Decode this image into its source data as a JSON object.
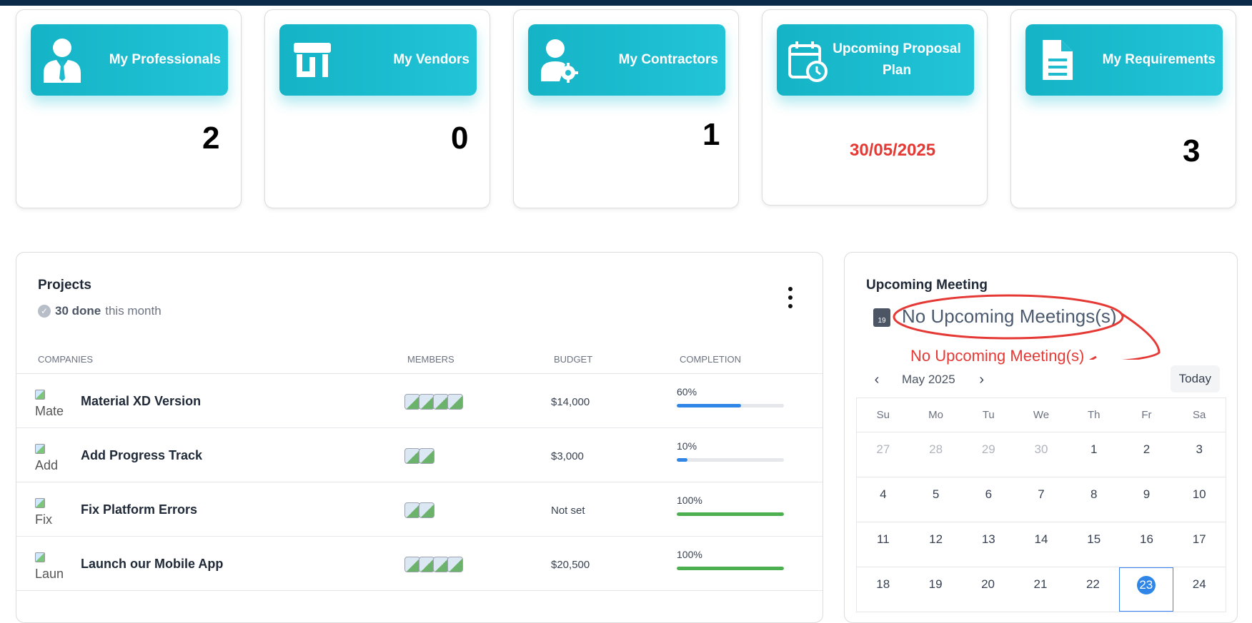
{
  "stats": [
    {
      "title": "My Professionals",
      "value": "2",
      "icon": "professional-icon"
    },
    {
      "title": "My Vendors",
      "value": "0",
      "icon": "store-icon"
    },
    {
      "title": "My Contractors",
      "value": "1",
      "icon": "user-gear-icon"
    },
    {
      "title": "Upcoming Proposal Plan",
      "value": "30/05/2025",
      "icon": "calendar-clock-icon"
    },
    {
      "title": "My Requirements",
      "value": "3",
      "icon": "document-icon"
    }
  ],
  "projects": {
    "title": "Projects",
    "done_count": "30 done",
    "done_suffix": "this month",
    "columns": [
      "COMPANIES",
      "MEMBERS",
      "BUDGET",
      "COMPLETION"
    ],
    "rows": [
      {
        "logo_alt": "Mate",
        "name": "Material XD Version",
        "members": 4,
        "budget": "$14,000",
        "completion_label": "60%",
        "completion": 0.6,
        "bar_color": "#2f86e6"
      },
      {
        "logo_alt": "Add",
        "name": "Add Progress Track",
        "members": 2,
        "budget": "$3,000",
        "completion_label": "10%",
        "completion": 0.1,
        "bar_color": "#2f86e6"
      },
      {
        "logo_alt": "Fix",
        "name": "Fix Platform Errors",
        "members": 2,
        "budget": "Not set",
        "completion_label": "100%",
        "completion": 1.0,
        "bar_color": "#4caf50"
      },
      {
        "logo_alt": "Laun",
        "name": "Launch our Mobile App",
        "members": 4,
        "budget": "$20,500",
        "completion_label": "100%",
        "completion": 1.0,
        "bar_color": "#4caf50"
      }
    ]
  },
  "meeting": {
    "title": "Upcoming Meeting",
    "calendar_icon_text": "19",
    "no_meetings": "No Upcoming Meetings(s)",
    "annotation": "No Upcoming Meeting(s)",
    "month_label": "May 2025",
    "today_label": "Today",
    "weekdays": [
      "Su",
      "Mo",
      "Tu",
      "We",
      "Th",
      "Fr",
      "Sa"
    ],
    "weeks": [
      [
        "27",
        "28",
        "29",
        "30",
        "1",
        "2",
        "3"
      ],
      [
        "4",
        "5",
        "6",
        "7",
        "8",
        "9",
        "10"
      ],
      [
        "11",
        "12",
        "13",
        "14",
        "15",
        "16",
        "17"
      ],
      [
        "18",
        "19",
        "20",
        "21",
        "22",
        "23",
        "24"
      ]
    ],
    "today_day": "23",
    "annotation_color": "#e53935"
  }
}
